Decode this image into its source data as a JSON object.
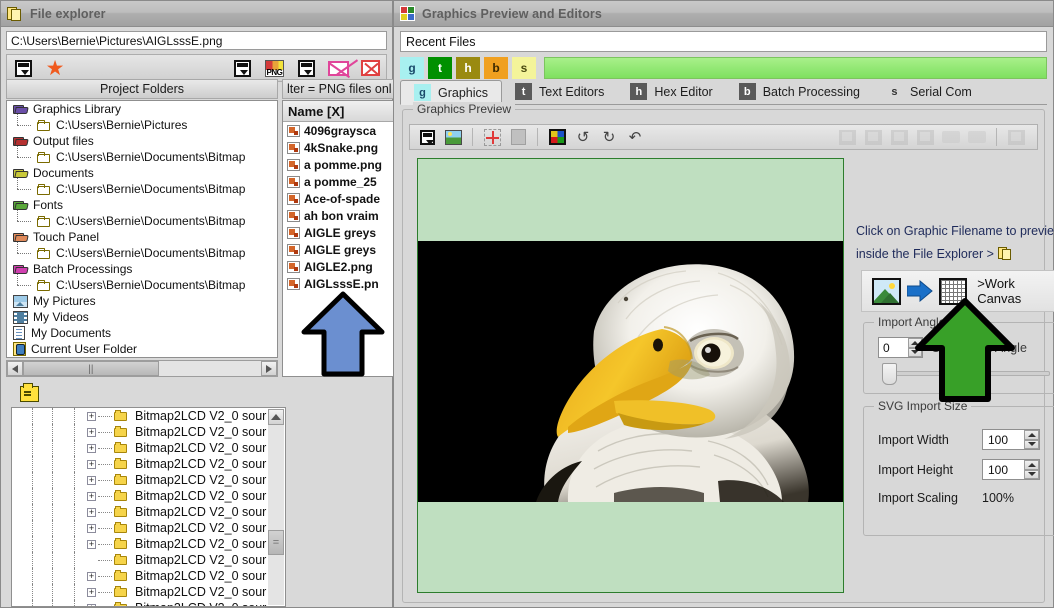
{
  "file_explorer": {
    "title": "File explorer",
    "title_icon": "pages-icon",
    "path_value": "C:\\Users\\Bernie\\Pictures\\AIGLsssE.png",
    "toolbar": [
      {
        "name": "drive-left-icon",
        "glyph": "drive"
      },
      {
        "name": "favorites-star-icon",
        "glyph": "star"
      },
      {
        "name": "drive-mid-icon",
        "glyph": "drive"
      },
      {
        "name": "png-filter-icon",
        "glyph": "png",
        "label": "PNG"
      },
      {
        "name": "drive-right-icon",
        "glyph": "drive"
      },
      {
        "name": "delete-envelope-icon",
        "glyph": "envx"
      },
      {
        "name": "delete-box-icon",
        "glyph": "boxx"
      }
    ],
    "tree_header": "Project Folders",
    "tree_items": [
      {
        "label": "Graphics Library",
        "icon": "open-folder-purple-icon",
        "level": 0,
        "color": "#6a4fa8"
      },
      {
        "label": "C:\\Users\\Bernie\\Pictures",
        "icon": "folder-icon",
        "level": 1
      },
      {
        "label": "Output files",
        "icon": "open-folder-red-icon",
        "level": 0,
        "color": "#b53030"
      },
      {
        "label": "C:\\Users\\Bernie\\Documents\\Bitmap",
        "icon": "folder-icon",
        "level": 1
      },
      {
        "label": "Documents",
        "icon": "open-folder-yellow-icon",
        "level": 0,
        "color": "#c8c83a"
      },
      {
        "label": "C:\\Users\\Bernie\\Documents\\Bitmap",
        "icon": "folder-icon",
        "level": 1
      },
      {
        "label": "Fonts",
        "icon": "open-folder-green-icon",
        "level": 0,
        "color": "#5aa83a"
      },
      {
        "label": "C:\\Users\\Bernie\\Documents\\Bitmap",
        "icon": "folder-icon",
        "level": 1
      },
      {
        "label": "Touch Panel",
        "icon": "open-folder-orange-icon",
        "level": 0,
        "color": "#e08a5a"
      },
      {
        "label": "C:\\Users\\Bernie\\Documents\\Bitmap",
        "icon": "folder-icon",
        "level": 1
      },
      {
        "label": "Batch Processings",
        "icon": "open-folder-magenta-icon",
        "level": 0,
        "color": "#d040b0"
      },
      {
        "label": "C:\\Users\\Bernie\\Documents\\Bitmap",
        "icon": "folder-icon",
        "level": 1
      },
      {
        "label": "My Pictures",
        "icon": "pictures-icon",
        "level": 0
      },
      {
        "label": "My Videos",
        "icon": "videos-icon",
        "level": 0
      },
      {
        "label": "My Documents",
        "icon": "documents-icon",
        "level": 0
      },
      {
        "label": "Current User Folder",
        "icon": "user-folder-icon",
        "level": 0
      }
    ],
    "filter_header": "lter = PNG files onl",
    "file_column_header": "Name [X]",
    "files": [
      "4096graysca",
      "4kSnake.png",
      "a pomme.png",
      "a pomme_25",
      "Ace-of-spade",
      "ah bon vraim",
      "AIGLE greys",
      "AIGLE greys",
      "AIGLE2.png",
      "AIGLsssE.pn"
    ],
    "bottom_tree_rows": [
      {
        "label": "Bitmap2LCD V2_0 sour",
        "expandable": true
      },
      {
        "label": "Bitmap2LCD V2_0 sour",
        "expandable": true
      },
      {
        "label": "Bitmap2LCD V2_0 sour",
        "expandable": true
      },
      {
        "label": "Bitmap2LCD V2_0 sour",
        "expandable": true
      },
      {
        "label": "Bitmap2LCD V2_0 sour",
        "expandable": true
      },
      {
        "label": "Bitmap2LCD V2_0 sour",
        "expandable": true
      },
      {
        "label": "Bitmap2LCD V2_0 sour",
        "expandable": true
      },
      {
        "label": "Bitmap2LCD V2_0 sour",
        "expandable": true
      },
      {
        "label": "Bitmap2LCD V2_0 sour",
        "expandable": true
      },
      {
        "label": "Bitmap2LCD V2_0 sour",
        "expandable": false
      },
      {
        "label": "Bitmap2LCD V2_0 sour",
        "expandable": true
      },
      {
        "label": "Bitmap2LCD V2_0 sour",
        "expandable": true
      },
      {
        "label": "Bitmap2LCD V2_0 sour",
        "expandable": true
      }
    ],
    "expand_glyph": "+",
    "folder_up_icon": "folder-up-icon"
  },
  "graphics_window": {
    "title": "Graphics Preview and Editors",
    "title_icon": "color-squares-icon",
    "quad_colors": [
      "#d43a3a",
      "#2a8a2a",
      "#e0d020",
      "#3a6ac8"
    ],
    "recent_files_label": "Recent Files",
    "badges": [
      {
        "letter": "g",
        "bg": "#a8f0f0",
        "fg": "#1a4a6a"
      },
      {
        "letter": "t",
        "bg": "#009000",
        "fg": "#ffffff"
      },
      {
        "letter": "h",
        "bg": "#9a8a10",
        "fg": "#ffffff"
      },
      {
        "letter": "b",
        "bg": "#f0a020",
        "fg": "#3a2800"
      },
      {
        "letter": "s",
        "bg": "#f4f49a",
        "fg": "#4a4a10"
      }
    ],
    "tabs": [
      {
        "label": "Graphics",
        "letter": "g",
        "badge_bg": "#a8f0f0",
        "badge_fg": "#1a4a6a",
        "active": true
      },
      {
        "label": "Text Editors",
        "letter": "t",
        "badge_bg": "#5a5a5a",
        "badge_fg": "#ffffff",
        "active": false
      },
      {
        "label": "Hex Editor",
        "letter": "h",
        "badge_bg": "#5a5a5a",
        "badge_fg": "#ffffff",
        "active": false
      },
      {
        "label": "Batch Processing",
        "letter": "b",
        "badge_bg": "#5a5a5a",
        "badge_fg": "#ffffff",
        "active": false
      },
      {
        "label": "Serial Com",
        "letter": "s",
        "badge_bg": "#d8d8d8",
        "badge_fg": "#333333",
        "active": false
      }
    ],
    "preview_group_label": "Graphics Preview",
    "toolbar_icons": [
      {
        "name": "drive-icon",
        "glyph": "drive",
        "disabled": false
      },
      {
        "name": "image-icon",
        "glyph": "pic2",
        "disabled": false
      },
      {
        "name": "move-selection-icon",
        "glyph": "move",
        "disabled": false
      },
      {
        "name": "grey-square-icon",
        "glyph": "greysq",
        "disabled": false
      },
      {
        "name": "color-palette-icon",
        "glyph": "rgb",
        "disabled": false
      },
      {
        "name": "flip-horizontal-icon",
        "glyph": "flip1",
        "disabled": false
      },
      {
        "name": "flip-vertical-icon",
        "glyph": "flip2",
        "disabled": false
      },
      {
        "name": "rotate-icon",
        "glyph": "flip3",
        "disabled": false
      }
    ],
    "toolbar_disabled_icons": [
      {
        "name": "align-top-left-icon"
      },
      {
        "name": "align-top-right-icon"
      },
      {
        "name": "align-bottom-left-icon"
      },
      {
        "name": "align-bottom-right-icon"
      },
      {
        "name": "distribute-horizontal-icon"
      },
      {
        "name": "fit-canvas-icon"
      },
      {
        "name": "copy-page-icon"
      }
    ],
    "canvas": {
      "background_color": "#bfdfc0",
      "border_color": "#2d7d2d",
      "image_background": "#000000",
      "image_subject": "bald-eagle-photo"
    },
    "hint_line1": "Click on Graphic Filename to previe",
    "hint_line2": "inside the File Explorer >",
    "hint_icon": "pages-icon",
    "work_canvas_button": {
      "label": ">Work Canvas",
      "from_icon": "photo-icon",
      "arrow_icon": "blue-arrow-right-icon",
      "to_icon": "grid-canvas-icon"
    },
    "import_angle": {
      "group_label": "Import Angle",
      "value": "0",
      "field_label": "Orientation Angle"
    },
    "svg_import": {
      "group_label": "SVG Import Size",
      "rows": [
        {
          "label": "Import Width",
          "value": "100",
          "type": "spin"
        },
        {
          "label": "Import Height",
          "value": "100",
          "type": "spin"
        },
        {
          "label": "Import Scaling",
          "value": "100%",
          "type": "text"
        }
      ]
    }
  },
  "annotations": {
    "blue_arrow": {
      "name": "blue-up-arrow-annotation",
      "color": "#6b8fd0",
      "outline": "#000000"
    },
    "green_arrow": {
      "name": "green-up-arrow-annotation",
      "color": "#38a028",
      "outline": "#000000"
    }
  }
}
